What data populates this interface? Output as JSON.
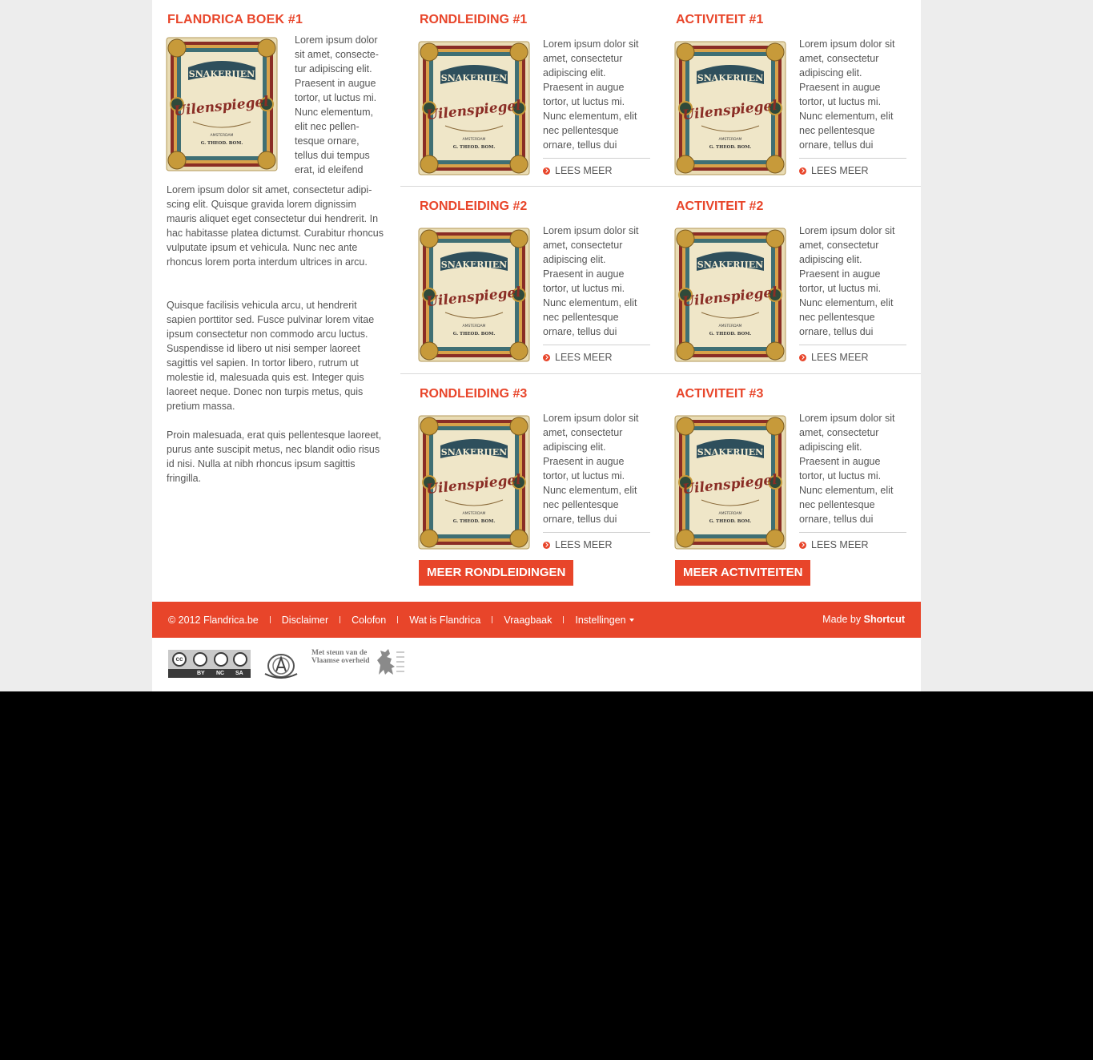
{
  "left": {
    "title": "FLANDRICA BOEK #1",
    "intro": "Lorem ipsum dolor sit amet, consecte­tur adipiscing elit. Praesent in augue tortor, ut luctus mi. Nunc elementum, elit nec pellen­tesque ornare, tellus dui tempus erat, id eleifend",
    "paragraphs": [
      "Lorem ipsum dolor sit amet, consectetur adipi­scing elit. Quisque gravida lorem dignissim mauris aliquet eget consectetur dui hendrerit. In hac habitasse platea dictumst. Curabitur rhoncus vulputate ipsum et vehicula. Nunc nec ante rhoncus lorem porta interdum ultrices in arcu.",
      "Quisque facilisis vehicula arcu, ut hendrerit sapien porttitor sed. Fusce pulvinar lorem vitae ipsum consectetur non commodo arcu luctus. Suspendisse id libero ut nisi semper laoreet sagittis vel sapien. In tortor libero, rutrum ut molestie id, malesuada quis est. Integer quis laoreet neque. Donec non turpis metus, quis pretium massa.",
      "Proin malesuada, erat quis pellentesque laoreet, purus ante suscipit metus, nec blandit odio risus id nisi. Nulla at nibh rhoncus ipsum sagittis fringilla."
    ]
  },
  "cells": [
    {
      "title": "RONDLEIDING #1",
      "text": "Lorem ipsum dolor sit amet, consectetur adipiscing elit. Praesent in augue tortor, ut luctus mi. Nunc elementum, elit nec pellentesque ornare, tellus dui",
      "more": "LEES MEER"
    },
    {
      "title": "ACTIVITEIT #1",
      "text": "Lorem ipsum dolor sit amet, consectetur adipiscing elit. Praesent in augue tortor, ut luctus mi. Nunc elementum, elit nec pellentesque ornare, tellus dui",
      "more": "LEES MEER"
    },
    {
      "title": "RONDLEIDING #2",
      "text": "Lorem ipsum dolor sit amet, consectetur adipiscing elit. Praesent in augue tortor, ut luctus mi. Nunc elementum, elit nec pellentesque ornare, tellus dui",
      "more": "LEES MEER"
    },
    {
      "title": "ACTIVITEIT #2",
      "text": "Lorem ipsum dolor sit amet, consectetur adipiscing elit. Praesent in augue tortor, ut luctus mi. Nunc elementum, elit nec pellentesque ornare, tellus dui",
      "more": "LEES MEER"
    },
    {
      "title": "RONDLEIDING #3",
      "text": "Lorem ipsum dolor sit amet, consectetur adipiscing elit. Praesent in augue tortor, ut luctus mi. Nunc elementum, elit nec pellentesque ornare, tellus dui",
      "more": "LEES MEER"
    },
    {
      "title": "ACTIVITEIT #3",
      "text": "Lorem ipsum dolor sit amet, consectetur adipiscing elit. Praesent in augue tortor, ut luctus mi. Nunc elementum, elit nec pellentesque ornare, tellus dui",
      "more": "LEES MEER"
    }
  ],
  "book_cover": {
    "title_line": "SNAKERIJEN",
    "script_line": "Uilenspiegel",
    "city": "AMSTERDAM",
    "publisher": "G. THEOD. BOM."
  },
  "buttons": {
    "more_tours": "MEER RONDLEIDINGEN",
    "more_activities": "MEER ACTIVITEITEN"
  },
  "footer": {
    "links": [
      "© 2012  Flandrica.be",
      "Disclaimer",
      "Colofon",
      "Wat is Flandrica",
      "Vraagbaak",
      "Instellingen"
    ],
    "made_by": "Made by",
    "made_by_name": "Shortcut"
  },
  "logos": {
    "cc_labels": [
      "BY",
      "NC",
      "SA"
    ],
    "cc_mark": "cc",
    "vlaams_text": "Met steun van de Vlaamse overheid"
  },
  "colors": {
    "accent": "#e8452a",
    "text": "#555555"
  }
}
